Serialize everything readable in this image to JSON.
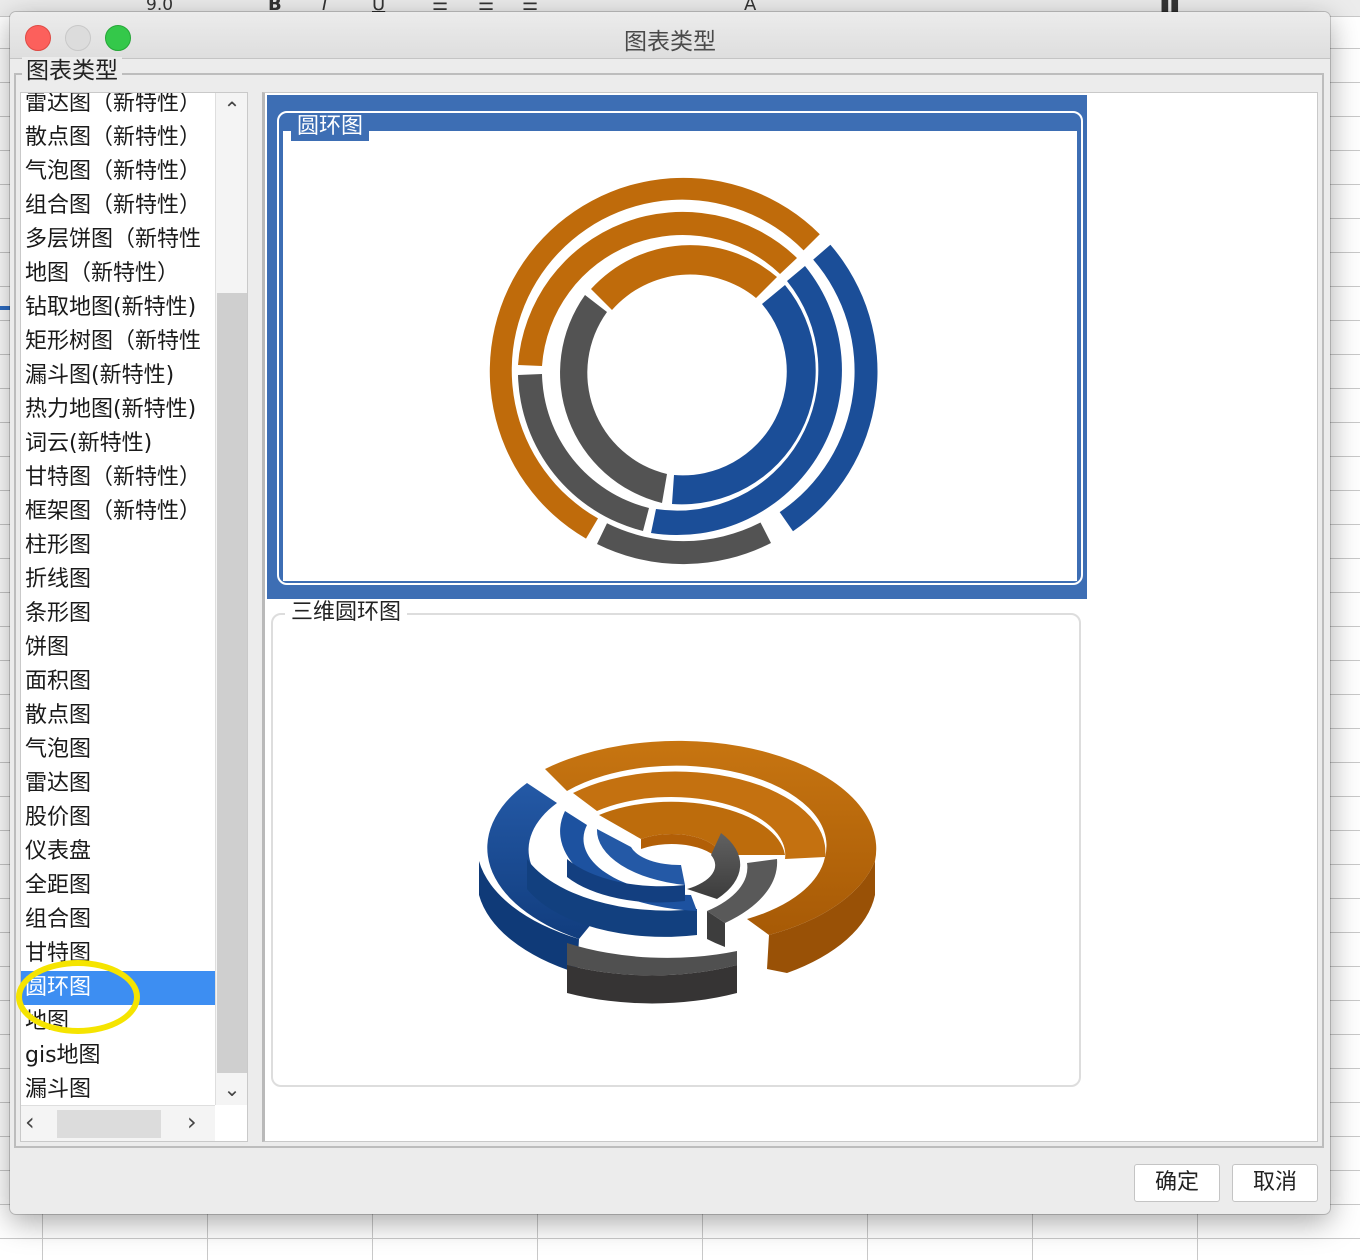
{
  "background_toolbar": {
    "font_size_value": "9.0"
  },
  "window": {
    "title": "图表类型"
  },
  "group": {
    "legend": "图表类型"
  },
  "chart_types": [
    "雷达图（新特性）",
    "散点图（新特性）",
    "气泡图（新特性）",
    "组合图（新特性）",
    "多层饼图（新特性",
    "地图（新特性）",
    "钻取地图(新特性)",
    "矩形树图（新特性",
    "漏斗图(新特性)",
    "热力地图(新特性)",
    "词云(新特性)",
    "甘特图（新特性）",
    "框架图（新特性）",
    "柱形图",
    "折线图",
    "条形图",
    "饼图",
    "面积图",
    "散点图",
    "气泡图",
    "雷达图",
    "股价图",
    "仪表盘",
    "全距图",
    "组合图",
    "甘特图",
    "圆环图",
    "地图",
    "gis地图",
    "漏斗图"
  ],
  "selected_index": 26,
  "preview": {
    "option1_title": "圆环图",
    "option2_title": "三维圆环图"
  },
  "buttons": {
    "ok": "确定",
    "cancel": "取消"
  },
  "colors": {
    "orange": "#bf6b0b",
    "blue": "#1b4e98",
    "gray": "#535353",
    "selection": "#3d6eb4",
    "list_selection": "#3d8ef2",
    "annotation": "#f5e400"
  }
}
